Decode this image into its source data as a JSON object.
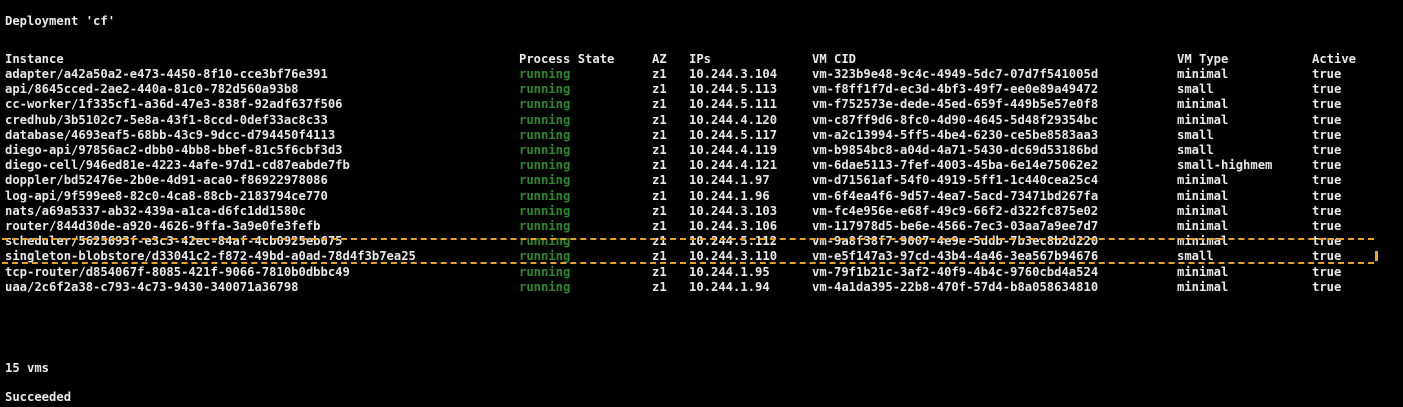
{
  "terminal": {
    "deployment_title": "Deployment 'cf'",
    "vm_count": "15 vms",
    "status": "Succeeded"
  },
  "table": {
    "headers": {
      "instance": "Instance",
      "process_state": "Process State",
      "az": "AZ",
      "ips": "IPs",
      "vm_cid": "VM CID",
      "vm_type": "VM Type",
      "active": "Active"
    },
    "rows": [
      {
        "instance": "adapter/a42a50a2-e473-4450-8f10-cce3bf76e391",
        "state": "running",
        "az": "z1",
        "ip": "10.244.3.104",
        "cid": "vm-323b9e48-9c4c-4949-5dc7-07d7f541005d",
        "type": "minimal",
        "active": "true"
      },
      {
        "instance": "api/8645cced-2ae2-440a-81c0-782d560a93b8",
        "state": "running",
        "az": "z1",
        "ip": "10.244.5.113",
        "cid": "vm-f8ff1f7d-ec3d-4bf3-49f7-ee0e89a49472",
        "type": "small",
        "active": "true"
      },
      {
        "instance": "cc-worker/1f335cf1-a36d-47e3-838f-92adf637f506",
        "state": "running",
        "az": "z1",
        "ip": "10.244.5.111",
        "cid": "vm-f752573e-dede-45ed-659f-449b5e57e0f8",
        "type": "minimal",
        "active": "true"
      },
      {
        "instance": "credhub/3b5102c7-5e8a-43f1-8ccd-0def33ac8c33",
        "state": "running",
        "az": "z1",
        "ip": "10.244.4.120",
        "cid": "vm-c87ff9d6-8fc0-4d90-4645-5d48f29354bc",
        "type": "minimal",
        "active": "true"
      },
      {
        "instance": "database/4693eaf5-68bb-43c9-9dcc-d794450f4113",
        "state": "running",
        "az": "z1",
        "ip": "10.244.5.117",
        "cid": "vm-a2c13994-5ff5-4be4-6230-ce5be8583aa3",
        "type": "small",
        "active": "true"
      },
      {
        "instance": "diego-api/97856ac2-dbb0-4bb8-bbef-81c5f6cbf3d3",
        "state": "running",
        "az": "z1",
        "ip": "10.244.4.119",
        "cid": "vm-b9854bc8-a04d-4a71-5430-dc69d53186bd",
        "type": "small",
        "active": "true"
      },
      {
        "instance": "diego-cell/946ed81e-4223-4afe-97d1-cd87eabde7fb",
        "state": "running",
        "az": "z1",
        "ip": "10.244.4.121",
        "cid": "vm-6dae5113-7fef-4003-45ba-6e14e75062e2",
        "type": "small-highmem",
        "active": "true"
      },
      {
        "instance": "doppler/bd52476e-2b0e-4d91-aca0-f86922978086",
        "state": "running",
        "az": "z1",
        "ip": "10.244.1.97",
        "cid": "vm-d71561af-54f0-4919-5ff1-1c440cea25c4",
        "type": "minimal",
        "active": "true"
      },
      {
        "instance": "log-api/9f599ee8-82c0-4ca8-88cb-2183794ce770",
        "state": "running",
        "az": "z1",
        "ip": "10.244.1.96",
        "cid": "vm-6f4ea4f6-9d57-4ea7-5acd-73471bd267fa",
        "type": "minimal",
        "active": "true"
      },
      {
        "instance": "nats/a69a5337-ab32-439a-a1ca-d6fc1dd1580c",
        "state": "running",
        "az": "z1",
        "ip": "10.244.3.103",
        "cid": "vm-fc4e956e-e68f-49c9-66f2-d322fc875e02",
        "type": "minimal",
        "active": "true"
      },
      {
        "instance": "router/844d30de-a920-4626-9ffa-3a9e0fe3fefb",
        "state": "running",
        "az": "z1",
        "ip": "10.244.3.106",
        "cid": "vm-117978d5-be6e-4566-7ec3-03aa7a9ee7d7",
        "type": "minimal",
        "active": "true"
      },
      {
        "instance": "scheduler/5625693f-e3c3-42ec-84af-4cb0925eb675",
        "state": "running",
        "az": "z1",
        "ip": "10.244.5.112",
        "cid": "vm-9a8f38f7-9007-4e9e-5ddb-7b3ec8b2d220",
        "type": "minimal",
        "active": "true"
      },
      {
        "instance": "singleton-blobstore/d33041c2-f872-49bd-a0ad-78d4f3b7ea25",
        "state": "running",
        "az": "z1",
        "ip": "10.244.3.110",
        "cid": "vm-e5f147a3-97cd-43b4-4a46-3ea567b94676",
        "type": "small",
        "active": "true"
      },
      {
        "instance": "tcp-router/d854067f-8085-421f-9066-7810b0dbbc49",
        "state": "running",
        "az": "z1",
        "ip": "10.244.1.95",
        "cid": "vm-79f1b21c-3af2-40f9-4b4c-9760cbd4a524",
        "type": "minimal",
        "active": "true"
      },
      {
        "instance": "uaa/2c6f2a38-c793-4c73-9430-340071a36798",
        "state": "running",
        "az": "z1",
        "ip": "10.244.1.94",
        "cid": "vm-4a1da395-22b8-470f-57d4-b8a058634810",
        "type": "minimal",
        "active": "true"
      }
    ]
  },
  "colors": {
    "background": "#000000",
    "text": "#e9e9e9",
    "running": "#2a8a2a",
    "highlight": "#e6a224"
  }
}
